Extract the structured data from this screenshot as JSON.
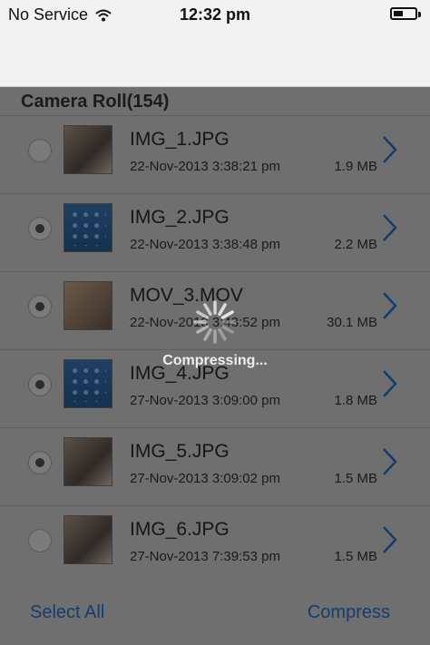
{
  "status_bar": {
    "carrier": "No Service",
    "time": "12:32 pm"
  },
  "section": {
    "title": "Camera Roll(154)"
  },
  "items": [
    {
      "name": "IMG_1.JPG",
      "date": "22-Nov-2013 3:38:21 pm",
      "size": "1.9 MB",
      "selected": false,
      "thumb": "photo"
    },
    {
      "name": "IMG_2.JPG",
      "date": "22-Nov-2013 3:38:48 pm",
      "size": "2.2 MB",
      "selected": true,
      "thumb": "screen"
    },
    {
      "name": "MOV_3.MOV",
      "date": "22-Nov-2013 3:43:52 pm",
      "size": "30.1 MB",
      "selected": true,
      "thumb": "blur"
    },
    {
      "name": "IMG_4.JPG",
      "date": "27-Nov-2013 3:09:00 pm",
      "size": "1.8 MB",
      "selected": true,
      "thumb": "screen"
    },
    {
      "name": "IMG_5.JPG",
      "date": "27-Nov-2013 3:09:02 pm",
      "size": "1.5 MB",
      "selected": true,
      "thumb": "photo"
    },
    {
      "name": "IMG_6.JPG",
      "date": "27-Nov-2013 7:39:53 pm",
      "size": "1.5 MB",
      "selected": false,
      "thumb": "photo"
    }
  ],
  "footer": {
    "select_all": "Select All",
    "compress": "Compress"
  },
  "progress_hud": {
    "label": "Compressing..."
  },
  "icons": {
    "wifi": "wifi-icon",
    "battery": "battery-icon",
    "chevron": "chevron-right-icon",
    "spinner": "activity-spinner-icon"
  },
  "colors": {
    "accent": "#123d70",
    "overlay": "#6f6f6f"
  }
}
